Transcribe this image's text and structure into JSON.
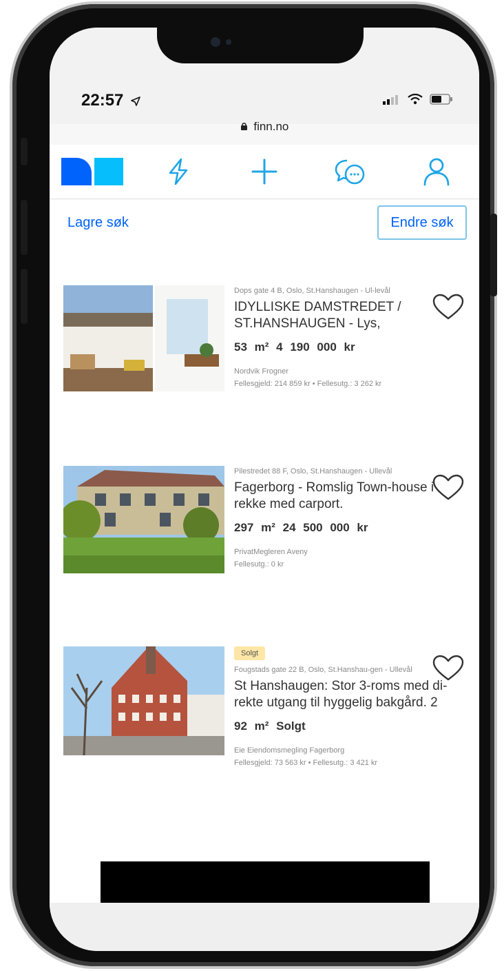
{
  "status": {
    "time": "22:57",
    "url": "finn.no"
  },
  "nav": {
    "logo_name": "finn-logo",
    "icons": [
      "lightning-icon",
      "plus-icon",
      "chat-bubbles-icon",
      "user-icon"
    ]
  },
  "search": {
    "save_label": "Lagre søk",
    "edit_label": "Endre søk"
  },
  "listings": [
    {
      "address": "Dops gate 4 B, Oslo, St.Hanshaugen - Ul-levål",
      "title": "IDYLLISKE DAMSTREDET / ST.HANSHAUGEN - Lys,",
      "size": "53 m²",
      "price": "4 190 000 kr",
      "broker": "Nordvik Frogner",
      "fees": "Fellesgjeld: 214 859 kr • Fellesutg.: 3 262 kr",
      "badge": ""
    },
    {
      "address": "Pilestredet 88 F, Oslo, St.Hanshaugen - Ullevål",
      "title": "Fagerborg - Romslig Town-house i rekke med carport.",
      "size": "297 m²",
      "price": "24 500 000 kr",
      "broker": "PrivatMegleren Aveny",
      "fees": "Fellesutg.: 0 kr",
      "badge": ""
    },
    {
      "address": "Fougstads gate 22 B, Oslo, St.Hanshau-gen - Ullevål",
      "title": "St Hanshaugen: Stor 3-roms med di-rekte utgang til hyggelig bakgård. 2",
      "size": "92 m²",
      "price": "Solgt",
      "broker": "Eie Eiendomsmegling Fagerborg",
      "fees": "Fellesgjeld: 73 563 kr • Fellesutg.: 3 421 kr",
      "badge": "Solgt"
    }
  ],
  "colors": {
    "brand_blue": "#0063fb",
    "brand_light": "#06befb",
    "nav_icon": "#1fa5e6",
    "sold_badge": "#fde6a6"
  }
}
